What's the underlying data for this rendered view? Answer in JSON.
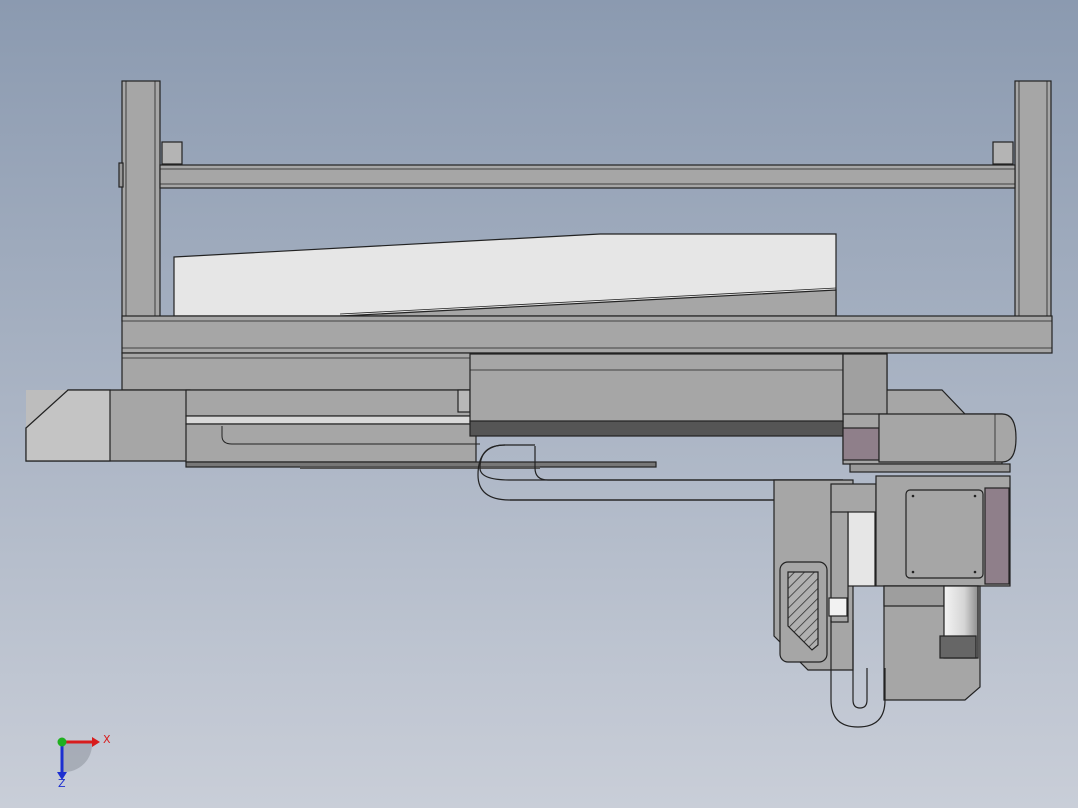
{
  "viewport": {
    "background_top": "#8b9ab0",
    "background_bottom": "#c9ced8"
  },
  "model": {
    "body_color": "#a6a6a6",
    "light_panel_color": "#e6e6e6",
    "dark_strip_color": "#555555",
    "accent_panel_color": "#8f7f8a",
    "edge_color": "#222222"
  },
  "triad": {
    "x_label": "X",
    "z_label": "Z",
    "x_axis_color": "#d81c1c",
    "y_axis_color": "#1fb01f",
    "z_axis_color": "#1c2fd0"
  }
}
